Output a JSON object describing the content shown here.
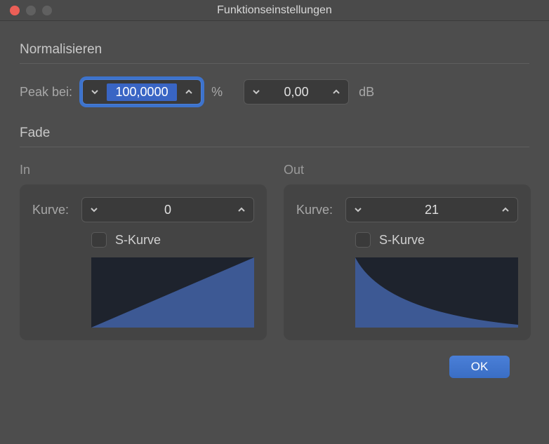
{
  "window": {
    "title": "Funktionseinstellungen"
  },
  "normalize": {
    "heading": "Normalisieren",
    "peak_label": "Peak bei:",
    "peak_percent_value": "100,0000",
    "percent_unit": "%",
    "peak_db_value": "0,00",
    "db_unit": "dB"
  },
  "fade": {
    "heading": "Fade",
    "in": {
      "subhead": "In",
      "curve_label": "Kurve:",
      "curve_value": "0",
      "scurve_label": "S-Kurve",
      "scurve_checked": false
    },
    "out": {
      "subhead": "Out",
      "curve_label": "Kurve:",
      "curve_value": "21",
      "scurve_label": "S-Kurve",
      "scurve_checked": false
    }
  },
  "footer": {
    "ok_label": "OK"
  }
}
